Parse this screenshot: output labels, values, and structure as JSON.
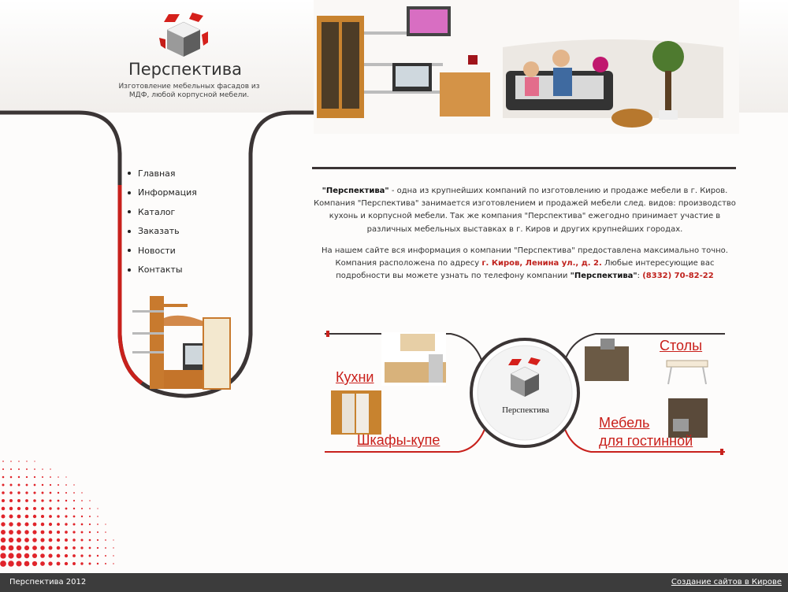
{
  "brand": {
    "name": "Перспектива",
    "tagline": "Изготовление мебельных фасадов из МДФ, любой корпусной мебели."
  },
  "nav": {
    "items": [
      {
        "label": "Главная"
      },
      {
        "label": "Информация"
      },
      {
        "label": "Каталог"
      },
      {
        "label": "Заказать"
      },
      {
        "label": "Новости"
      },
      {
        "label": "Контакты"
      }
    ]
  },
  "intro": {
    "p1_brand": "\"Перспектива\"",
    "p1_text": " - одна из крупнейших компаний по изготовлению и продаже мебели в г. Киров. Компания \"Перспектива\" занимается изготовлением и продажей мебели след. видов: производство кухонь и корпусной мебели. Так же компания \"Перспектива\" ежегодно принимает участие в различных мебельных выставках в г. Киров и других крупнейших городах.",
    "p2_text": "На нашем сайте вся информация о компании \"Перспектива\" предоставлена максимально точно. Компания расположена по адресу ",
    "address": "г. Киров, Ленина ул., д. 2.",
    "p2_text2": " Любые интересующие вас подробности вы можете узнать по телефону компании ",
    "p2_brand": "\"Перспектива\"",
    "p2_colon": ": ",
    "phone": "(8332) 70-82-22"
  },
  "banner": {
    "kitchens": "Кухни",
    "wardrobes": "Шкафы-купе",
    "tables": "Столы",
    "living_line1": "Мебель",
    "living_line2": "для гостинной",
    "center_label": "Перспектива"
  },
  "footer": {
    "copyright": "Перспектива 2012",
    "credit": "Создание сайтов в Кирове"
  },
  "colors": {
    "accent": "#c91f1a",
    "dark": "#3c3c3c"
  }
}
